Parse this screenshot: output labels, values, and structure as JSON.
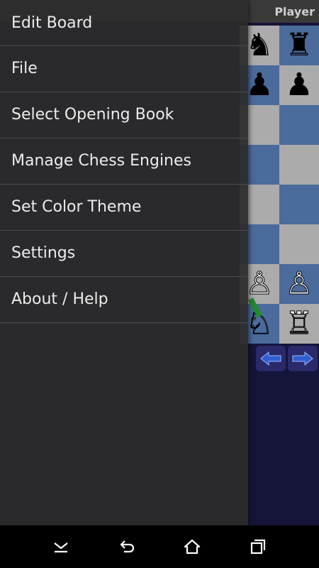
{
  "titlebar": {
    "player_label": "Player"
  },
  "drawer": {
    "items": [
      {
        "label": "Edit Board"
      },
      {
        "label": "File"
      },
      {
        "label": "Select Opening Book"
      },
      {
        "label": "Manage Chess Engines"
      },
      {
        "label": "Set Color Theme"
      },
      {
        "label": "Settings"
      },
      {
        "label": "About / Help"
      }
    ]
  },
  "board": {
    "visible_pieces": [
      {
        "square": "g8",
        "piece": "knight",
        "color": "black",
        "glyph": "♞"
      },
      {
        "square": "h8",
        "piece": "rook",
        "color": "black",
        "glyph": "♜"
      },
      {
        "square": "g7",
        "piece": "pawn",
        "color": "black",
        "glyph": "♟"
      },
      {
        "square": "h7",
        "piece": "pawn",
        "color": "black",
        "glyph": "♟"
      },
      {
        "square": "g2",
        "piece": "pawn",
        "color": "white",
        "glyph": "♙"
      },
      {
        "square": "h2",
        "piece": "pawn",
        "color": "white",
        "glyph": "♙"
      },
      {
        "square": "g1",
        "piece": "knight",
        "color": "white",
        "glyph": "♘"
      },
      {
        "square": "h1",
        "piece": "rook",
        "color": "white",
        "glyph": "♖"
      }
    ]
  },
  "controls": {
    "back_icon": "arrow-left-icon",
    "forward_icon": "arrow-right-icon"
  },
  "navbar": {
    "icons": [
      "hide-keyboard-icon",
      "back-icon",
      "home-icon",
      "recents-icon"
    ]
  },
  "colors": {
    "drawer_bg": "#2c2c2c",
    "light_square": "#ababab",
    "dark_square": "#4a6b9c",
    "app_bg": "#15153a"
  }
}
